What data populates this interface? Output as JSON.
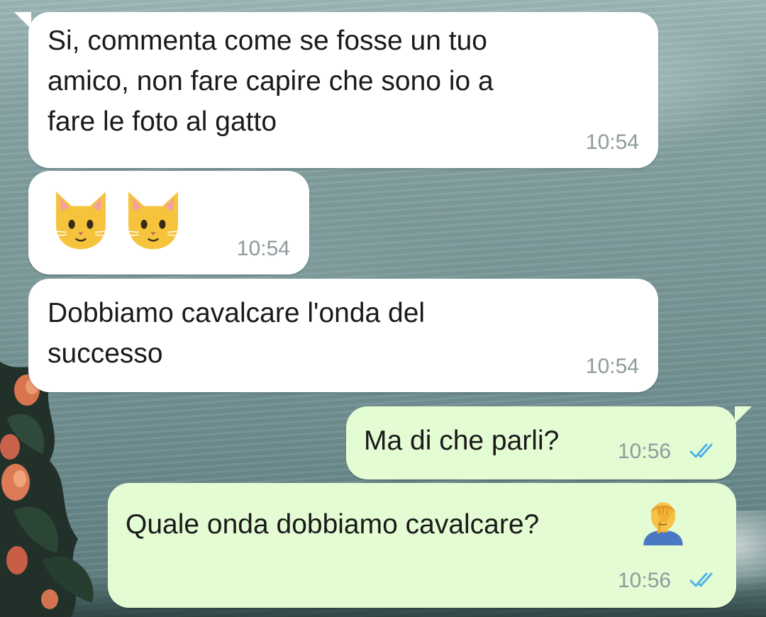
{
  "conversation": {
    "messages": [
      {
        "direction": "incoming",
        "text": "Si, commenta come se fosse un tuo\namico, non fare capire che sono io a\nfare le foto al gatto",
        "time": "10:54"
      },
      {
        "direction": "incoming",
        "emojis": [
          "cat-face-icon",
          "cat-face-icon"
        ],
        "time": "10:54"
      },
      {
        "direction": "incoming",
        "text": "Dobbiamo cavalcare l'onda del\nsuccesso",
        "time": "10:54"
      },
      {
        "direction": "outgoing",
        "text": "Ma di che parli?",
        "time": "10:56",
        "status": "read"
      },
      {
        "direction": "outgoing",
        "text": "Quale onda dobbiamo cavalcare?",
        "emoji": "facepalm-icon",
        "time": "10:56",
        "status": "read"
      }
    ]
  },
  "colors": {
    "incoming_bubble": "#ffffff",
    "outgoing_bubble": "#e4fcd3",
    "read_ticks": "#4fb3e8",
    "timestamp": "#8f9a9c"
  }
}
